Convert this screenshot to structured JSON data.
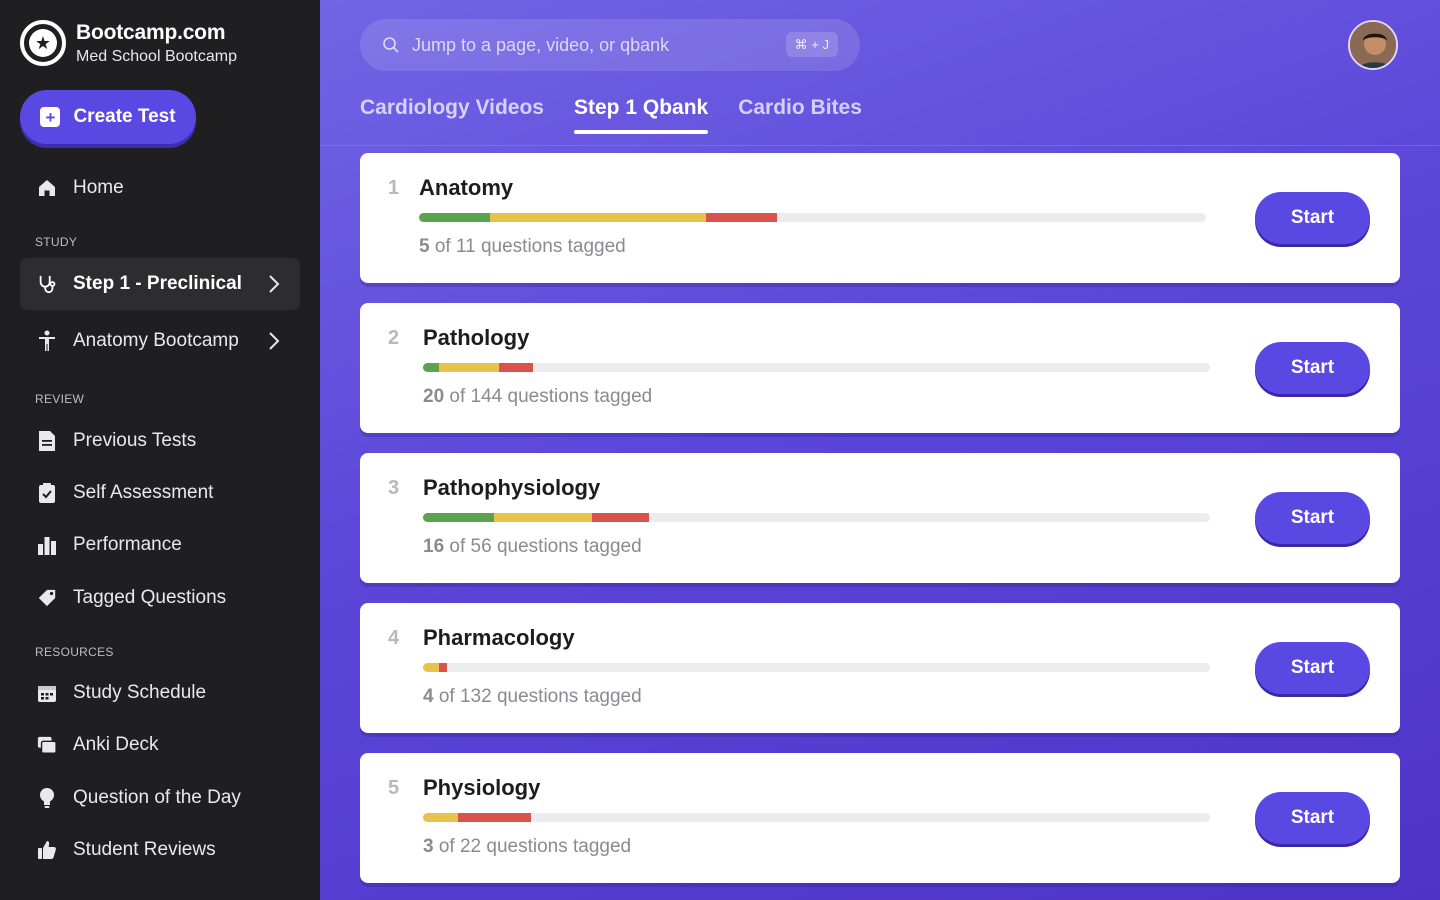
{
  "brand": {
    "name": "Bootcamp.com",
    "subtitle": "Med School Bootcamp"
  },
  "sidebar": {
    "create_label": "Create Test",
    "home_label": "Home",
    "sections": {
      "study": "STUDY",
      "review": "REVIEW",
      "resources": "RESOURCES"
    },
    "study_items": [
      {
        "label": "Step 1 - Preclinical",
        "icon": "stethoscope-icon",
        "active": true
      },
      {
        "label": "Anatomy Bootcamp",
        "icon": "person-icon",
        "active": false
      }
    ],
    "review_items": [
      {
        "label": "Previous Tests",
        "icon": "document-icon"
      },
      {
        "label": "Self Assessment",
        "icon": "clipboard-check-icon"
      },
      {
        "label": "Performance",
        "icon": "bar-chart-icon"
      },
      {
        "label": "Tagged Questions",
        "icon": "tag-icon"
      }
    ],
    "resource_items": [
      {
        "label": "Study Schedule",
        "icon": "calendar-icon"
      },
      {
        "label": "Anki Deck",
        "icon": "cards-icon"
      },
      {
        "label": "Question of the Day",
        "icon": "lightbulb-icon"
      },
      {
        "label": "Student Reviews",
        "icon": "thumbs-up-icon"
      }
    ]
  },
  "search": {
    "placeholder": "Jump to a page, video, or qbank",
    "shortcut": "⌘ + J"
  },
  "tabs": [
    {
      "label": "Cardiology Videos",
      "active": false
    },
    {
      "label": "Step 1 Qbank",
      "active": true
    },
    {
      "label": "Cardio Bites",
      "active": false
    }
  ],
  "topics": [
    {
      "index": "1",
      "title": "Anatomy",
      "tagged": "5",
      "total": "of 11 questions tagged",
      "green": 0.09,
      "yellow": 0.275,
      "red": 0.09
    },
    {
      "index": "2",
      "title": "Pathology",
      "tagged": "20",
      "total": "of 144 questions tagged",
      "green": 0.02,
      "yellow": 0.077,
      "red": 0.043
    },
    {
      "index": "3",
      "title": "Pathophysiology",
      "tagged": "16",
      "total": "of 56 questions tagged",
      "green": 0.09,
      "yellow": 0.125,
      "red": 0.072
    },
    {
      "index": "4",
      "title": "Pharmacology",
      "tagged": "4",
      "total": "of 132 questions tagged",
      "green": 0.0,
      "yellow": 0.02,
      "red": 0.01
    },
    {
      "index": "5",
      "title": "Physiology",
      "tagged": "3",
      "total": "of 22 questions tagged",
      "green": 0.0,
      "yellow": 0.045,
      "red": 0.092
    }
  ],
  "start_label": "Start",
  "colors": {
    "accent": "#5a48e2",
    "green": "#5aa34f",
    "yellow": "#e8c34a",
    "red": "#d9534c",
    "sidebar_bg": "#1f1f21"
  }
}
